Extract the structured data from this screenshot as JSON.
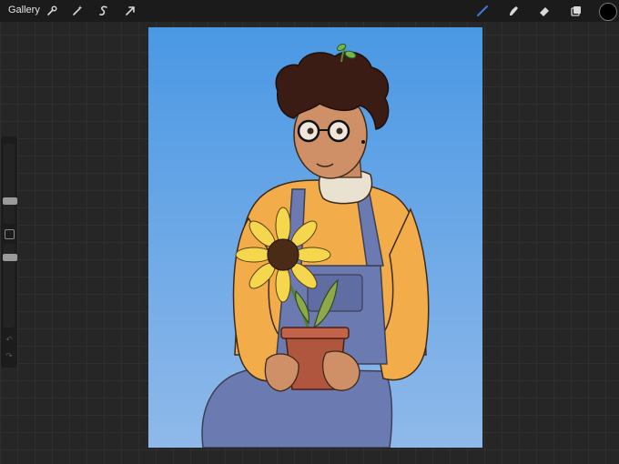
{
  "toolbar": {
    "gallery_label": "Gallery",
    "icons_left": [
      "wrench-icon",
      "magic-wand-icon",
      "selection-icon",
      "transform-arrow-icon"
    ],
    "icons_right": [
      "brush-icon",
      "smudge-icon",
      "eraser-icon",
      "layers-icon",
      "color-swatch"
    ],
    "active_tool_color": "#3a7bd5",
    "current_color": "#000000"
  },
  "sidebar": {
    "brush_size_level": 0.26,
    "opacity_level": 0.26
  },
  "canvas": {
    "background_color": "#5aa3e6"
  }
}
